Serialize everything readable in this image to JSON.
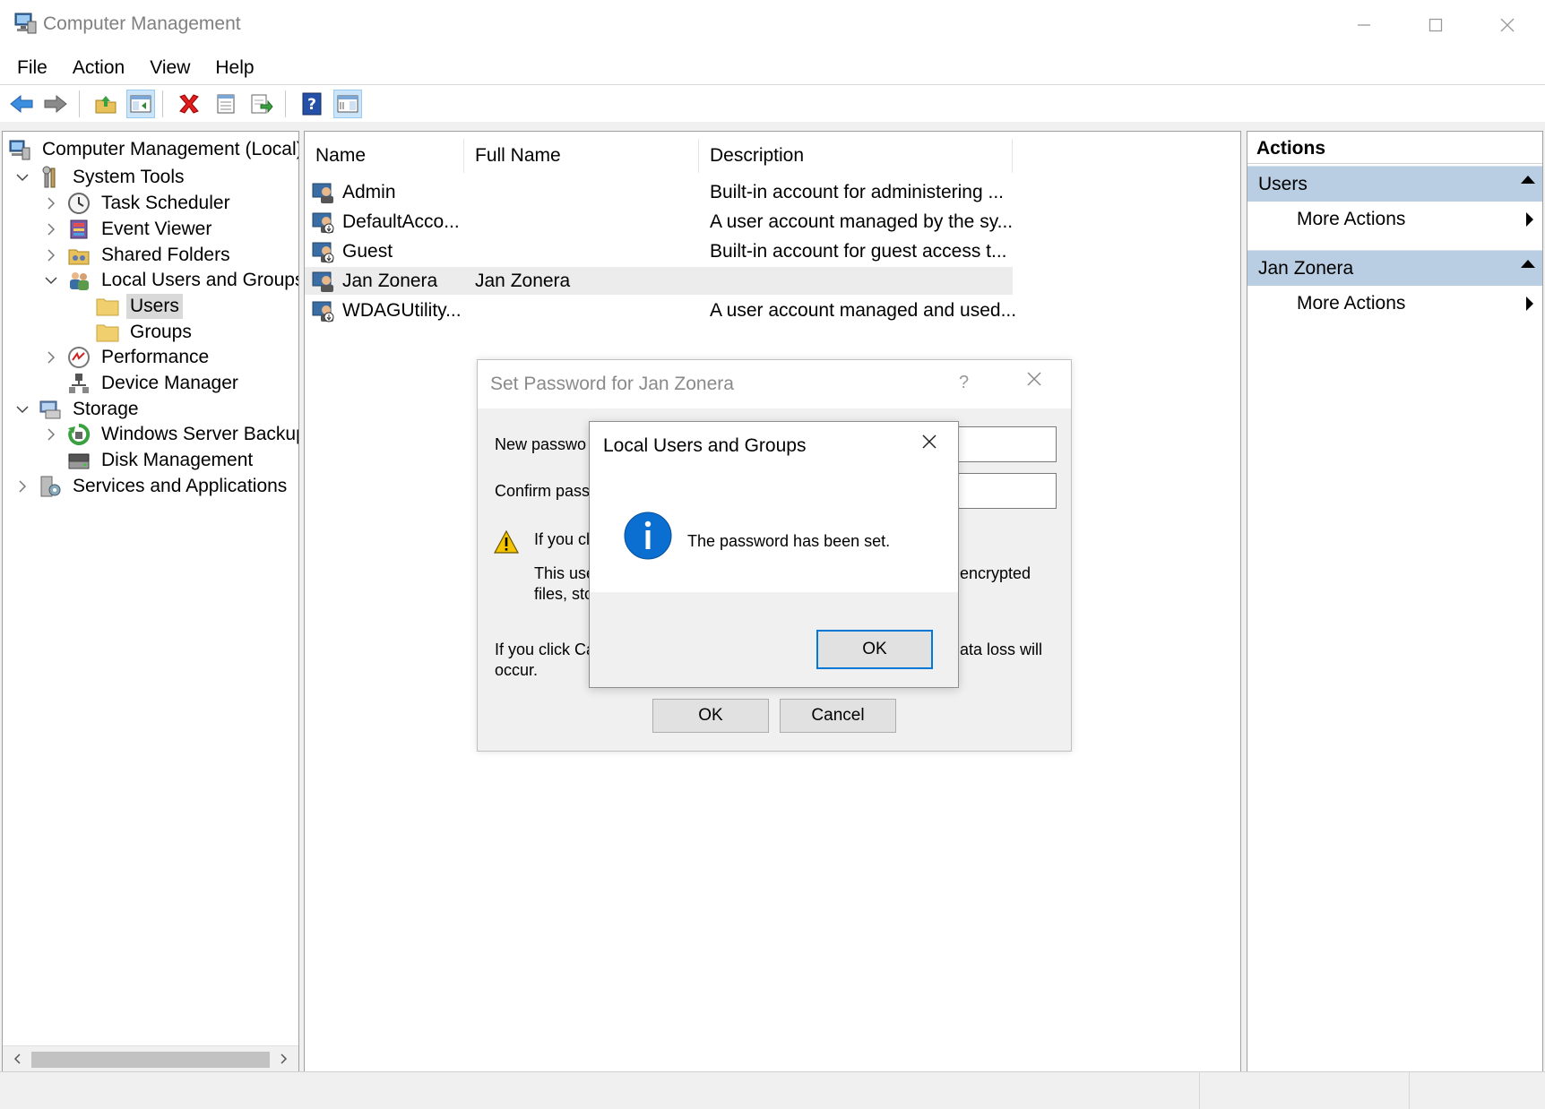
{
  "window": {
    "title": "Computer Management",
    "controls": {
      "minimize": "minimize-icon",
      "maximize": "maximize-icon",
      "close": "close-icon"
    }
  },
  "menu": [
    "File",
    "Action",
    "View",
    "Help"
  ],
  "toolbar": [
    "back-arrow-icon",
    "forward-arrow-icon",
    "up-folder-icon",
    "show-hide-tree-icon",
    "delete-icon",
    "properties-icon",
    "export-list-icon",
    "help-icon",
    "show-hide-action-pane-icon"
  ],
  "tree": {
    "root": "Computer Management (Local)",
    "system_tools": "System Tools",
    "task_scheduler": "Task Scheduler",
    "event_viewer": "Event Viewer",
    "shared_folders": "Shared Folders",
    "local_users_groups": "Local Users and Groups",
    "users": "Users",
    "groups": "Groups",
    "performance": "Performance",
    "device_manager": "Device Manager",
    "storage": "Storage",
    "windows_server_backup": "Windows Server Backup",
    "disk_management": "Disk Management",
    "services_applications": "Services and Applications"
  },
  "list": {
    "columns": [
      "Name",
      "Full Name",
      "Description"
    ],
    "rows": [
      {
        "name": "Admin",
        "full_name": "",
        "description": "Built-in account for administering ..."
      },
      {
        "name": "DefaultAcco...",
        "full_name": "",
        "description": "A user account managed by the sy..."
      },
      {
        "name": "Guest",
        "full_name": "",
        "description": "Built-in account for guest access t..."
      },
      {
        "name": "Jan Zonera",
        "full_name": "Jan Zonera",
        "description": ""
      },
      {
        "name": "WDAGUtility...",
        "full_name": "",
        "description": "A user account managed and used..."
      }
    ]
  },
  "actions": {
    "title": "Actions",
    "group1": "Users",
    "group1_item": "More Actions",
    "group2": "Jan Zonera",
    "group2_item": "More Actions"
  },
  "set_password_dialog": {
    "title": "Set Password for Jan Zonera",
    "help": "?",
    "new_password_label": "New passwo",
    "confirm_password_label": "Confirm pass",
    "warning_line1": "If you cl",
    "body_line1_left": "This use",
    "body_line1_right": "encrypted",
    "body_line2_left": "files, sto",
    "cancel_note_line1_left": "If you click Ca",
    "cancel_note_line1_right": "ata loss will",
    "cancel_note_line2": "occur.",
    "ok": "OK",
    "cancel": "Cancel"
  },
  "message_box": {
    "title": "Local Users and Groups",
    "message": "The password has been set.",
    "icon": "info-icon",
    "ok": "OK"
  },
  "colors": {
    "selection": "#d9d9d9",
    "action_group": "#b9cee3",
    "focus_border": "#0078d7",
    "info_blue": "#0a6fd1"
  }
}
